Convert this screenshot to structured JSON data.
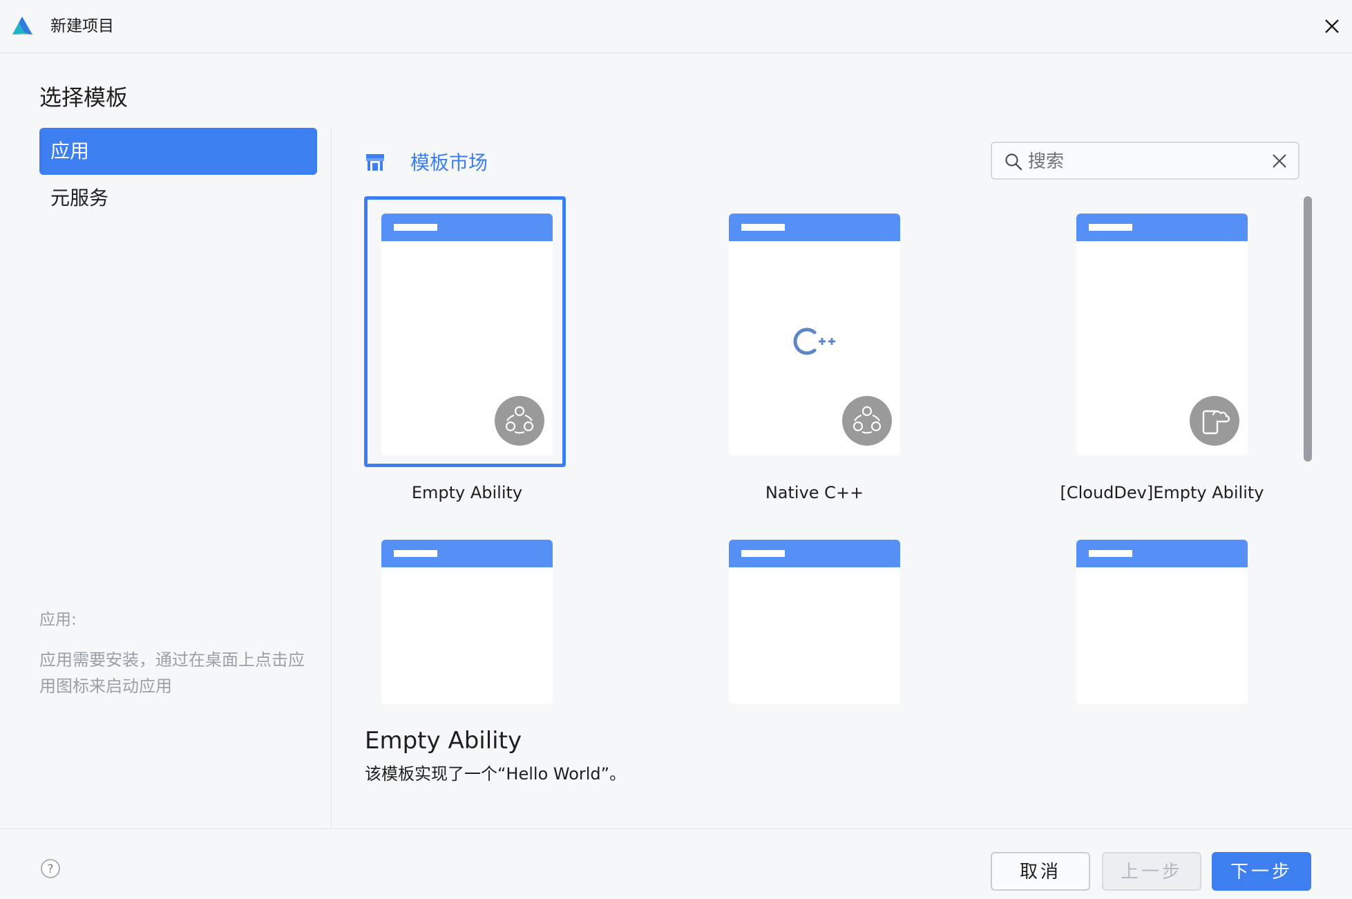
{
  "window": {
    "title": "新建项目",
    "close_icon": "close-icon",
    "logo_icon": "deveco-logo-icon"
  },
  "sidebar": {
    "heading": "选择模板",
    "items": [
      {
        "label": "应用",
        "selected": true
      },
      {
        "label": "元服务",
        "selected": false
      }
    ],
    "description_title": "应用:",
    "description_body": "应用需要安装，通过在桌面上点击应用图标来启动应用"
  },
  "toolbar": {
    "market_label": "模板市场",
    "market_icon": "store-icon",
    "search_placeholder": "搜索",
    "search_value": "",
    "search_icon": "search-icon",
    "clear_icon": "clear-icon"
  },
  "templates": [
    {
      "label": "Empty Ability",
      "selected": true,
      "badge_icon": "ability-badge-icon"
    },
    {
      "label": "Native C++",
      "selected": false,
      "badge_icon": "ability-badge-icon",
      "center_icon": "cpp-icon"
    },
    {
      "label": "[CloudDev]Empty Ability",
      "selected": false,
      "badge_icon": "cloud-phone-badge-icon"
    }
  ],
  "detail": {
    "title": "Empty Ability",
    "description": "该模板实现了一个“Hello World”。"
  },
  "footer": {
    "help_icon": "help-icon",
    "cancel_label": "取消",
    "prev_label": "上一步",
    "prev_enabled": false,
    "next_label": "下一步"
  },
  "colors": {
    "accent": "#3d7ef0",
    "card_header": "#5590f7",
    "badge": "#9a9a9a",
    "background": "#f6f7f9",
    "muted_text": "#9aa0a8"
  }
}
